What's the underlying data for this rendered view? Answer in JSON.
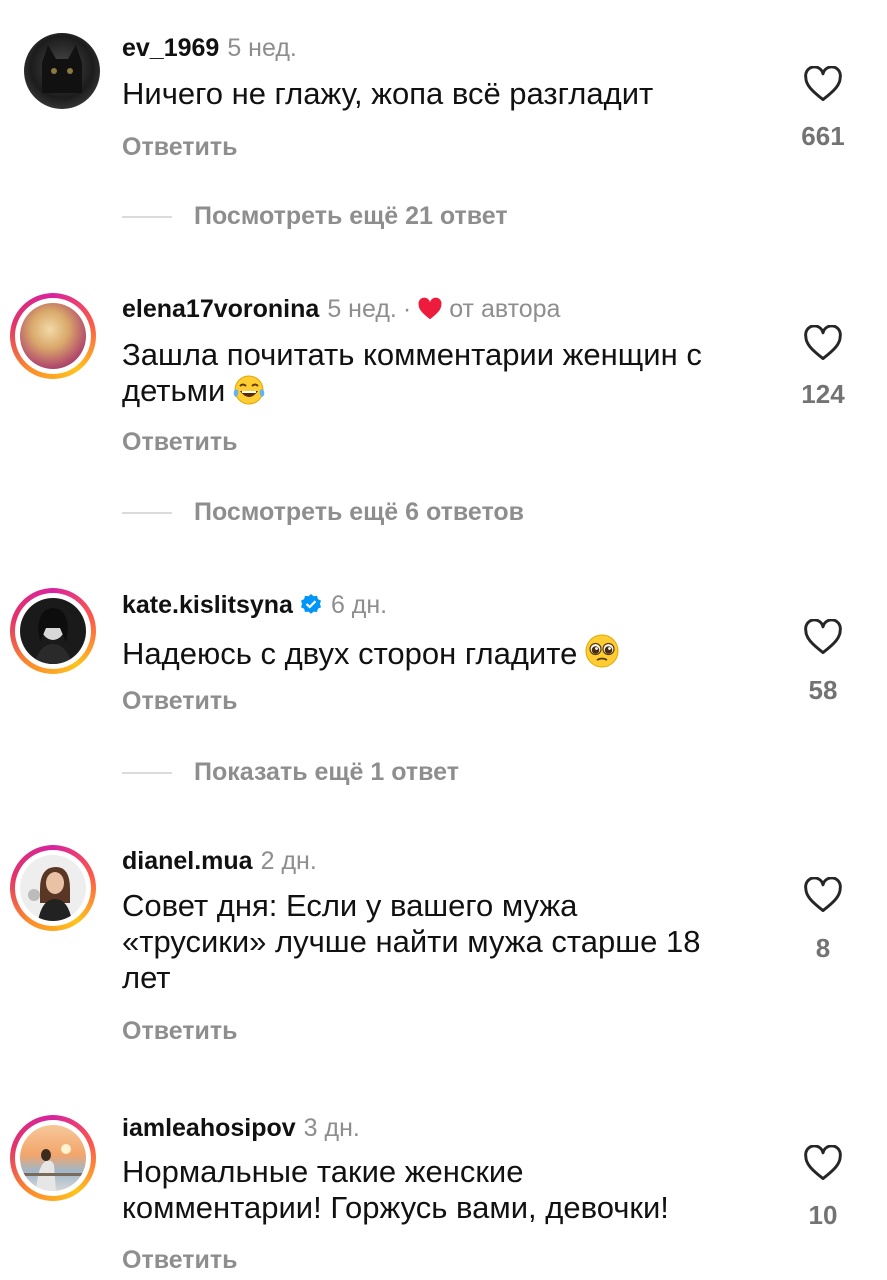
{
  "comments": [
    {
      "username": "ev_1969",
      "time": "5 нед.",
      "text": "Ничего не глажу, жопа всё разгладит",
      "reply_label": "Ответить",
      "likes": "661",
      "more_replies": "Посмотреть ещё 21 ответ"
    },
    {
      "username": "elena17voronina",
      "time": "5 нед.",
      "author_tag": "от автора",
      "text_line1": "Зашла почитать комментарии женщин с",
      "text_line2": "детьми",
      "reply_label": "Ответить",
      "likes": "124",
      "more_replies": "Посмотреть ещё 6 ответов"
    },
    {
      "username": "kate.kislitsyna",
      "time": "6 дн.",
      "text": "Надеюсь с двух сторон гладите",
      "reply_label": "Ответить",
      "likes": "58",
      "more_replies": "Показать ещё 1 ответ"
    },
    {
      "username": "dianel.mua",
      "time": "2 дн.",
      "text_line1": "Совет дня:  Если у вашего мужа",
      "text_line2": "«трусики» лучше найти мужа старше 18",
      "text_line3": "лет",
      "reply_label": "Ответить",
      "likes": "8"
    },
    {
      "username": "iamleahosipov",
      "time": "3 дн.",
      "text_line1": "Нормальные такие женские",
      "text_line2": "комментарии! Горжусь вами, девочки!",
      "reply_label": "Ответить",
      "likes": "10"
    }
  ],
  "colors": {
    "secondary": "#8e8e8e",
    "verified": "#0095f6",
    "heart_red": "#ed4956"
  },
  "icons": {
    "like": "heart-outline-icon",
    "verified": "verified-badge-icon",
    "author_like": "heart-filled-icon"
  }
}
